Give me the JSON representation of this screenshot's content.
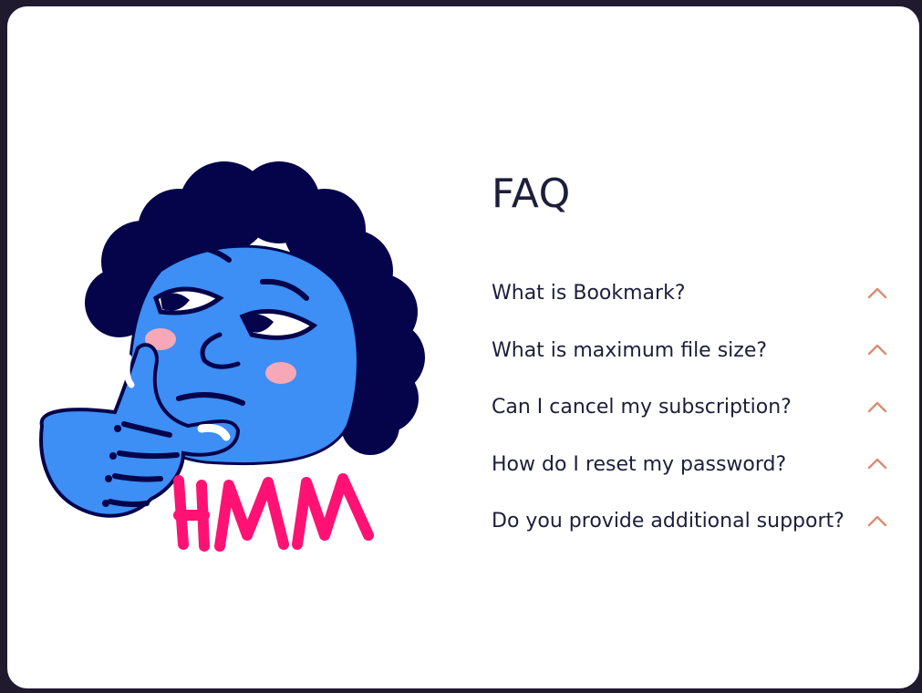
{
  "faq": {
    "title": "FAQ",
    "accent_color": "#d98d73",
    "items": [
      {
        "question": "What is Bookmark?",
        "icon": "chevron-up-icon"
      },
      {
        "question": "What is maximum file size?",
        "icon": "chevron-up-icon"
      },
      {
        "question": "Can I cancel my subscription?",
        "icon": "chevron-up-icon"
      },
      {
        "question": "How do I reset my password?",
        "icon": "chevron-up-icon"
      },
      {
        "question": "Do you provide additional support?",
        "icon": "chevron-up-icon"
      }
    ]
  },
  "illustration": {
    "subject": "thinking person",
    "colors": {
      "skin": "#3d8ef5",
      "hair": "#05034a",
      "text": "#ff1273",
      "blush": "#f7a8b8"
    }
  }
}
